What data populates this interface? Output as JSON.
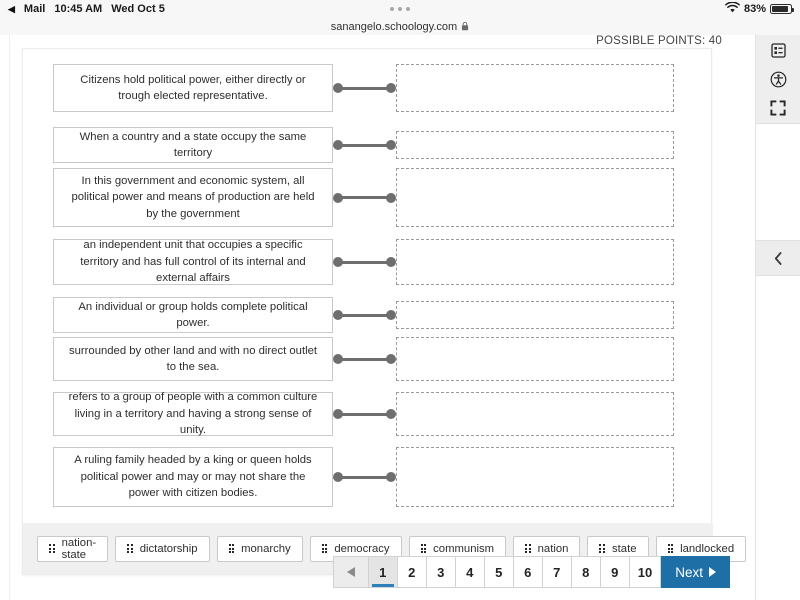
{
  "status_bar": {
    "back_label": "Mail",
    "back_icon": "triangle-left-icon",
    "time": "10:45 AM",
    "date": "Wed Oct 5",
    "tab_dots_icon": "tab-dots-icon",
    "wifi_icon": "wifi-icon",
    "battery_percent": "83%",
    "battery_icon": "battery-icon"
  },
  "browser": {
    "url": "sanangelo.schoology.com",
    "lock_icon": "lock-icon"
  },
  "rail": {
    "buttons": [
      {
        "icon": "list-view-icon",
        "name": "rail-button-list-view"
      },
      {
        "icon": "accessibility-icon",
        "name": "rail-button-accessibility"
      },
      {
        "icon": "fullscreen-icon",
        "name": "rail-button-fullscreen"
      }
    ],
    "collapse_icon": "chevron-left-icon"
  },
  "quiz": {
    "possible_points": "POSSIBLE POINTS: 40",
    "items": [
      {
        "prompt": "Citizens hold political power, either directly or trough elected representative.",
        "answer": ""
      },
      {
        "prompt": "When a country and a state occupy the same territory",
        "answer": ""
      },
      {
        "prompt": "In this government and economic system, all political power and means of production are held by the government",
        "answer": ""
      },
      {
        "prompt": "an independent unit that occupies a specific territory and has full control of its internal and external affairs",
        "answer": ""
      },
      {
        "prompt": "An individual or group holds complete political power.",
        "answer": ""
      },
      {
        "prompt": "surrounded by other land and with no direct outlet to the sea.",
        "answer": ""
      },
      {
        "prompt": "refers to a group of people with a common culture living in a territory and having a strong sense of unity.",
        "answer": ""
      },
      {
        "prompt": "A ruling family headed by a king or queen holds political power and may or may not share the power with citizen bodies.",
        "answer": ""
      }
    ],
    "choices": [
      {
        "label": "nation-state",
        "grip_icon": "drag-handle-icon"
      },
      {
        "label": "dictatorship",
        "grip_icon": "drag-handle-icon"
      },
      {
        "label": "monarchy",
        "grip_icon": "drag-handle-icon"
      },
      {
        "label": "democracy",
        "grip_icon": "drag-handle-icon"
      },
      {
        "label": "communism",
        "grip_icon": "drag-handle-icon"
      },
      {
        "label": "nation",
        "grip_icon": "drag-handle-icon"
      },
      {
        "label": "state",
        "grip_icon": "drag-handle-icon"
      },
      {
        "label": "landlocked",
        "grip_icon": "drag-handle-icon"
      }
    ]
  },
  "pagination": {
    "prev_icon": "triangle-left-icon",
    "pages": [
      "1",
      "2",
      "3",
      "4",
      "5",
      "6",
      "7",
      "8",
      "9",
      "10"
    ],
    "active_page": "1",
    "next_label": "Next",
    "next_icon": "triangle-right-icon"
  },
  "colors": {
    "accent_blue": "#1d6fa5",
    "active_underline": "#2f7fb8",
    "connector_grey": "#6e6e6e",
    "tray_grey": "#f0f0f0"
  }
}
